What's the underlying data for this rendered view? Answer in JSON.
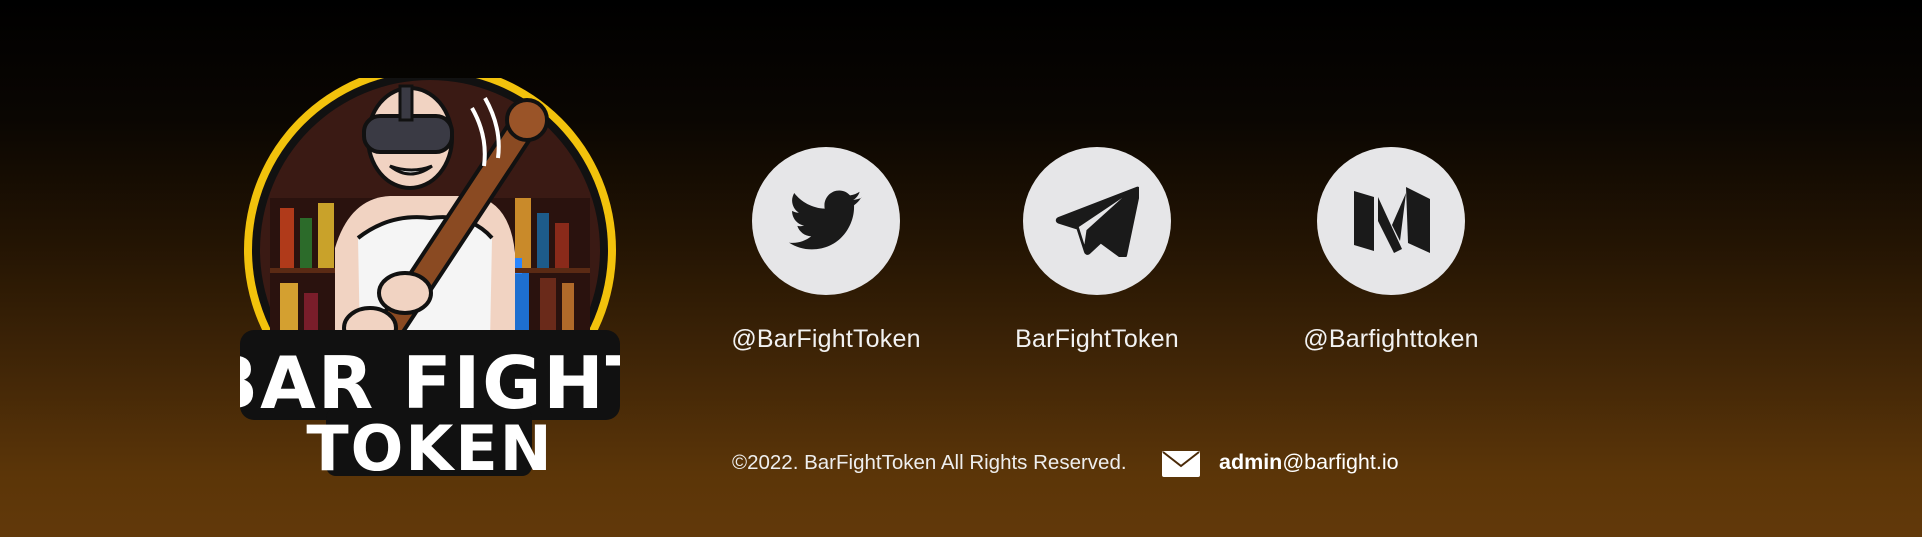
{
  "brand": {
    "logo_text_line1": "BAR FIGHT",
    "logo_text_line2": "TOKEN",
    "ring_color": "#f2c20c"
  },
  "social": [
    {
      "icon": "twitter-icon",
      "handle": "@BarFightToken"
    },
    {
      "icon": "telegram-icon",
      "handle": "BarFightToken"
    },
    {
      "icon": "medium-icon",
      "handle": "@Barfighttoken"
    }
  ],
  "footer": {
    "copyright": "©2022. BarFightToken All Rights Reserved.",
    "email_user": "admin",
    "email_domain": "@barfight.io",
    "mail_icon": "envelope-icon"
  },
  "colors": {
    "icon_circle": "#e6e6e8",
    "icon_glyph": "#1a1a1a",
    "gradient_top": "#000000",
    "gradient_bottom": "#62390a"
  }
}
